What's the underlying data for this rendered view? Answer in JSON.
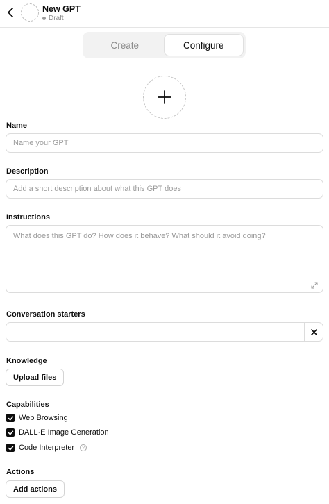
{
  "header": {
    "title": "New GPT",
    "status": "Draft"
  },
  "tabs": [
    {
      "label": "Create",
      "active": false
    },
    {
      "label": "Configure",
      "active": true
    }
  ],
  "form": {
    "name": {
      "label": "Name",
      "placeholder": "Name your GPT",
      "value": ""
    },
    "description": {
      "label": "Description",
      "placeholder": "Add a short description about what this GPT does",
      "value": ""
    },
    "instructions": {
      "label": "Instructions",
      "placeholder": "What does this GPT do? How does it behave? What should it avoid doing?",
      "value": ""
    },
    "conversation_starters": {
      "label": "Conversation starters",
      "value": ""
    },
    "knowledge": {
      "label": "Knowledge",
      "button": "Upload files"
    },
    "capabilities": {
      "label": "Capabilities",
      "items": [
        {
          "label": "Web Browsing",
          "checked": true
        },
        {
          "label": "DALL·E Image Generation",
          "checked": true
        },
        {
          "label": "Code Interpreter",
          "checked": true,
          "info": "?"
        }
      ]
    },
    "actions": {
      "label": "Actions",
      "button": "Add actions"
    }
  },
  "icons": {
    "back": "chevron-left-icon",
    "add_avatar": "plus-icon",
    "remove_starter": "close-icon",
    "resize": "expand-icon",
    "checkbox": "check-icon",
    "info": "info-icon"
  },
  "colors": {
    "text": "#0d0d0d",
    "muted": "#9a9a9a",
    "border": "#dcdcdc",
    "tab_bg": "#f2f2f2",
    "checkbox": "#0d0d0d"
  }
}
